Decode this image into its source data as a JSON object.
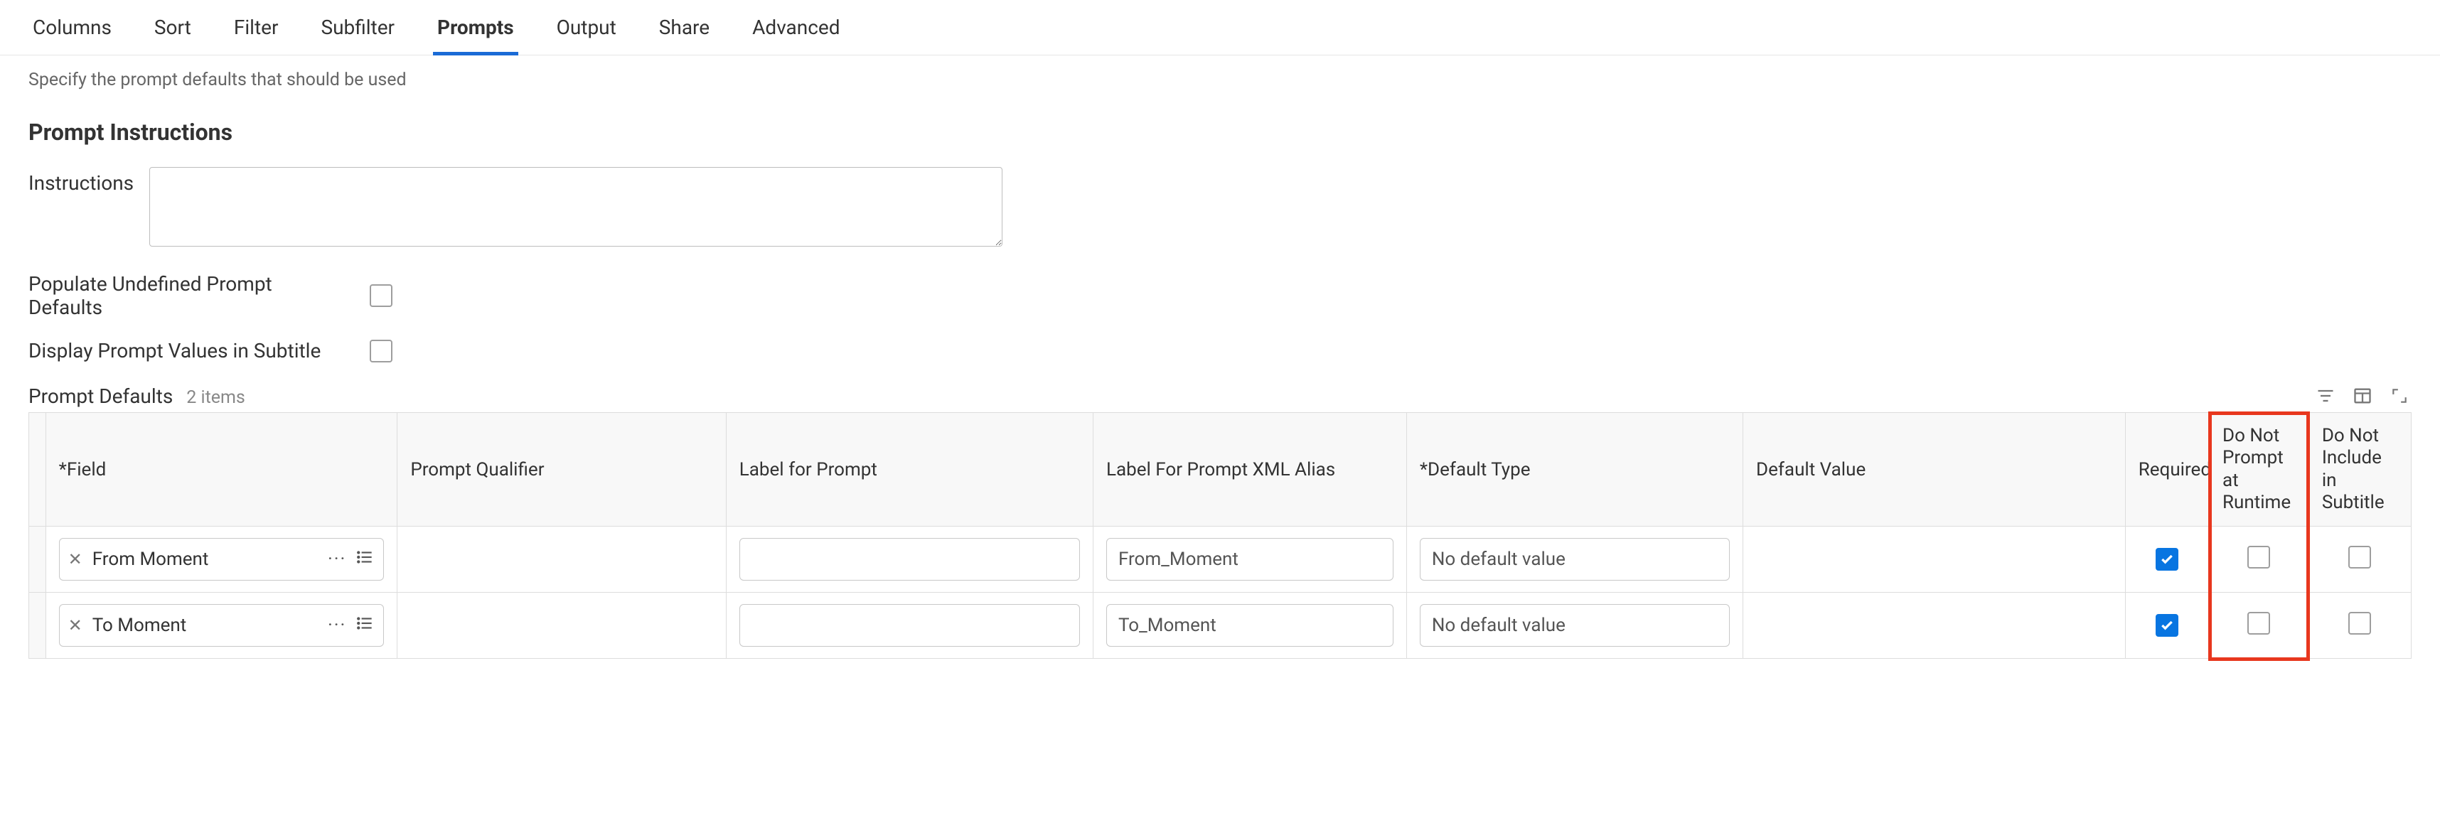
{
  "tabs": {
    "columns": "Columns",
    "sort": "Sort",
    "filter": "Filter",
    "subfilter": "Subfilter",
    "prompts": "Prompts",
    "output": "Output",
    "share": "Share",
    "advanced": "Advanced"
  },
  "helper_text": "Specify the prompt defaults that should be used",
  "section_title": "Prompt Instructions",
  "form": {
    "instructions_label": "Instructions",
    "instructions_value": "",
    "populate_label": "Populate Undefined Prompt Defaults",
    "populate_checked": false,
    "display_subtitle_label": "Display Prompt Values in Subtitle",
    "display_subtitle_checked": false
  },
  "table": {
    "title": "Prompt Defaults",
    "count_label": "2 items",
    "headers": {
      "field": "*Field",
      "qualifier": "Prompt Qualifier",
      "label": "Label for Prompt",
      "xml": "Label For Prompt XML Alias",
      "dtype": "*Default Type",
      "dval": "Default Value",
      "required": "Required",
      "noprompt": "Do Not Prompt at Runtime",
      "nosub": "Do Not Include in Subtitle"
    },
    "rows": [
      {
        "field": "From Moment",
        "qualifier": "",
        "label": "",
        "xml": "From_Moment",
        "dtype": "No default value",
        "dval": "",
        "required": true,
        "noprompt": false,
        "nosub": false
      },
      {
        "field": "To Moment",
        "qualifier": "",
        "label": "",
        "xml": "To_Moment",
        "dtype": "No default value",
        "dval": "",
        "required": true,
        "noprompt": false,
        "nosub": false
      }
    ]
  }
}
